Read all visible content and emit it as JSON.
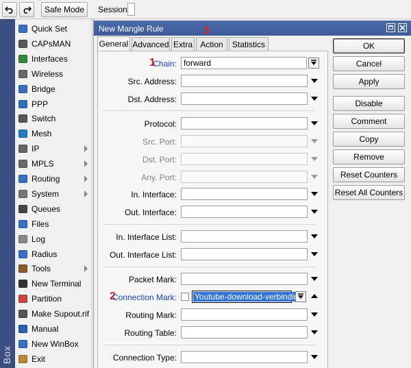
{
  "toolbar": {
    "undo_icon": "undo-icon",
    "redo_icon": "redo-icon",
    "safe_mode": "Safe Mode",
    "session_label": "Session:"
  },
  "side_strip_label": "Box",
  "menu": [
    {
      "label": "Quick Set",
      "icon": "quick-set-icon",
      "arrow": false
    },
    {
      "label": "CAPsMAN",
      "icon": "capsman-icon",
      "arrow": false
    },
    {
      "label": "Interfaces",
      "icon": "interfaces-icon",
      "arrow": false
    },
    {
      "label": "Wireless",
      "icon": "wireless-icon",
      "arrow": false
    },
    {
      "label": "Bridge",
      "icon": "bridge-icon",
      "arrow": false
    },
    {
      "label": "PPP",
      "icon": "ppp-icon",
      "arrow": false
    },
    {
      "label": "Switch",
      "icon": "switch-icon",
      "arrow": false
    },
    {
      "label": "Mesh",
      "icon": "mesh-icon",
      "arrow": false
    },
    {
      "label": "IP",
      "icon": "ip-icon",
      "arrow": true
    },
    {
      "label": "MPLS",
      "icon": "mpls-icon",
      "arrow": true
    },
    {
      "label": "Routing",
      "icon": "routing-icon",
      "arrow": true
    },
    {
      "label": "System",
      "icon": "system-icon",
      "arrow": true
    },
    {
      "label": "Queues",
      "icon": "queues-icon",
      "arrow": false
    },
    {
      "label": "Files",
      "icon": "files-icon",
      "arrow": false
    },
    {
      "label": "Log",
      "icon": "log-icon",
      "arrow": false
    },
    {
      "label": "Radius",
      "icon": "radius-icon",
      "arrow": false
    },
    {
      "label": "Tools",
      "icon": "tools-icon",
      "arrow": true
    },
    {
      "label": "New Terminal",
      "icon": "terminal-icon",
      "arrow": false
    },
    {
      "label": "Partition",
      "icon": "partition-icon",
      "arrow": false
    },
    {
      "label": "Make Supout.rif",
      "icon": "supout-icon",
      "arrow": false
    },
    {
      "label": "Manual",
      "icon": "manual-icon",
      "arrow": false
    },
    {
      "label": "New WinBox",
      "icon": "winbox-icon",
      "arrow": false
    },
    {
      "label": "Exit",
      "icon": "exit-icon",
      "arrow": false
    }
  ],
  "window": {
    "title": "New Mangle Rule",
    "tabs": [
      "General",
      "Advanced",
      "Extra",
      "Action",
      "Statistics"
    ],
    "active_tab": "General"
  },
  "form": {
    "chain_label": "Chain:",
    "chain_value": "forward",
    "src_address_label": "Src. Address:",
    "dst_address_label": "Dst. Address:",
    "protocol_label": "Protocol:",
    "src_port_label": "Src. Port:",
    "dst_port_label": "Dst. Port:",
    "any_port_label": "Any. Port:",
    "in_interface_label": "In. Interface:",
    "out_interface_label": "Out. Interface:",
    "in_interface_list_label": "In. Interface List:",
    "out_interface_list_label": "Out. Interface List:",
    "packet_mark_label": "Packet Mark:",
    "connection_mark_label": "Connection Mark:",
    "connection_mark_value": "Youtube-download-verbinding",
    "routing_mark_label": "Routing Mark:",
    "routing_table_label": "Routing Table:",
    "connection_type_label": "Connection Type:"
  },
  "buttons": {
    "ok": "OK",
    "cancel": "Cancel",
    "apply": "Apply",
    "disable": "Disable",
    "comment": "Comment",
    "copy": "Copy",
    "remove": "Remove",
    "reset_counters": "Reset Counters",
    "reset_all_counters": "Reset All Counters"
  },
  "annotations": {
    "marker1": "1",
    "marker2": "2",
    "marker3": "3"
  },
  "colors": {
    "titlebar": "#4a6aa8",
    "side_strip": "#3b4f82",
    "marker": "#e02020",
    "blue_label": "#1a3fb8",
    "selection": "#3072d6"
  }
}
